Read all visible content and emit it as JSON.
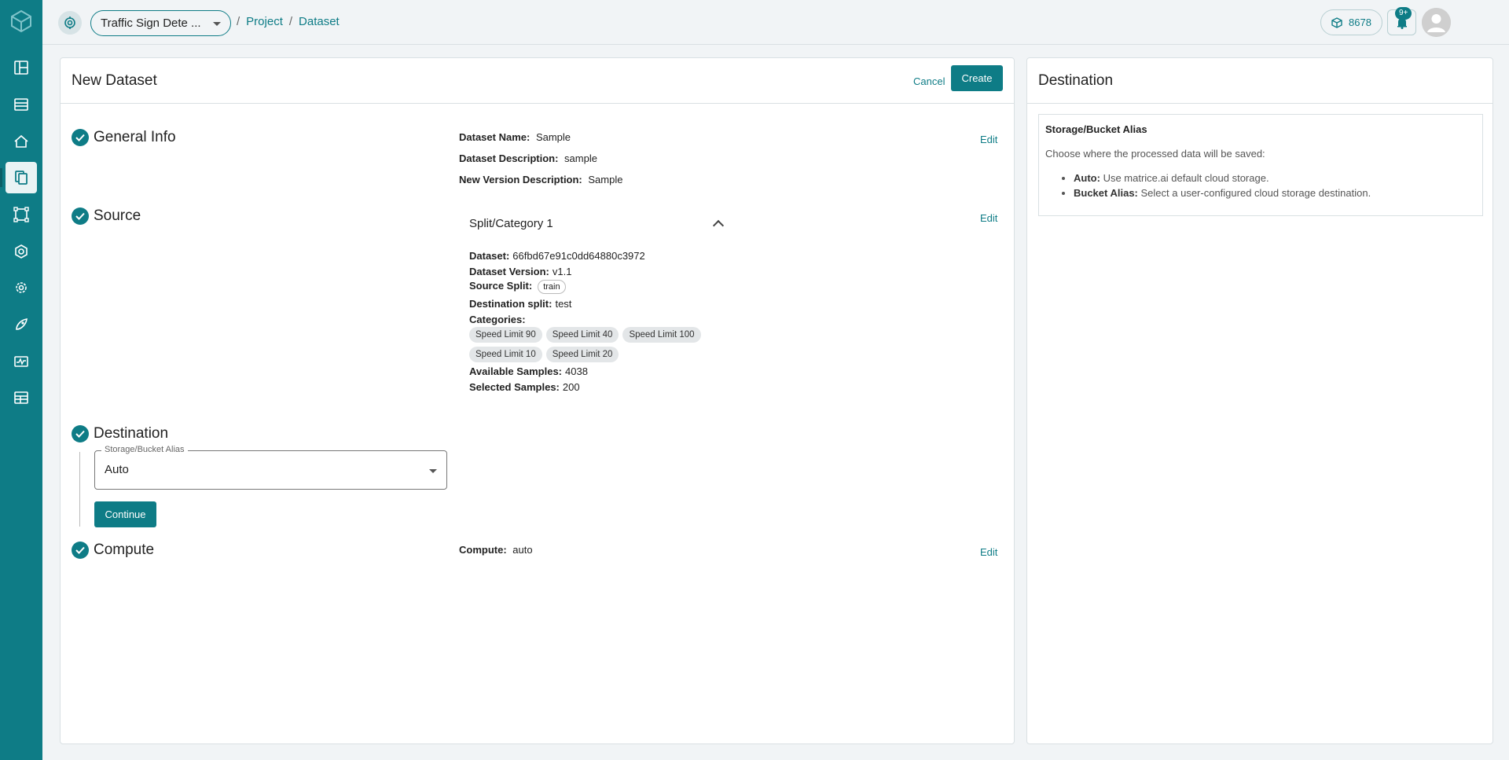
{
  "topbar": {
    "project_name": "Traffic Sign Dete ...",
    "breadcrumb": [
      "Project",
      "Dataset"
    ],
    "breadcrumb_sep": "/",
    "credits": "8678",
    "notifications_badge": "9+"
  },
  "main": {
    "title": "New Dataset",
    "cancel_label": "Cancel",
    "create_label": "Create",
    "edit_label": "Edit",
    "general_info": {
      "title": "General Info",
      "dataset_name_label": "Dataset Name:",
      "dataset_name": "Sample",
      "dataset_desc_label": "Dataset Description:",
      "dataset_desc": "sample",
      "version_desc_label": "New Version Description:",
      "version_desc": "Sample"
    },
    "source": {
      "title": "Source",
      "split_title": "Split/Category 1",
      "dataset_label": "Dataset:",
      "dataset": "66fbd67e91c0dd64880c3972",
      "version_label": "Dataset Version:",
      "version": "v1.1",
      "source_split_label": "Source Split:",
      "source_split": "train",
      "dest_split_label": "Destination split:",
      "dest_split": "test",
      "categories_label": "Categories:",
      "categories_row1": [
        "Speed Limit 90",
        "Speed Limit 40",
        "Speed Limit 100"
      ],
      "categories_row2": [
        "Speed Limit 10",
        "Speed Limit 20"
      ],
      "available_label": "Available Samples:",
      "available": "4038",
      "selected_label": "Selected Samples:",
      "selected": "200"
    },
    "destination": {
      "title": "Destination",
      "field_label": "Storage/Bucket Alias",
      "field_value": "Auto",
      "continue_label": "Continue"
    },
    "compute": {
      "title": "Compute",
      "label": "Compute:",
      "value": "auto"
    }
  },
  "side": {
    "title": "Destination",
    "box_title": "Storage/Bucket Alias",
    "desc": "Choose where the processed data will be saved:",
    "items": [
      {
        "term": "Auto:",
        "text": "Use matrice.ai default cloud storage."
      },
      {
        "term": "Bucket Alias:",
        "text": "Select a user-configured cloud storage destination."
      }
    ]
  },
  "colors": {
    "accent": "#0e7c86",
    "background": "#f1f4f6"
  }
}
